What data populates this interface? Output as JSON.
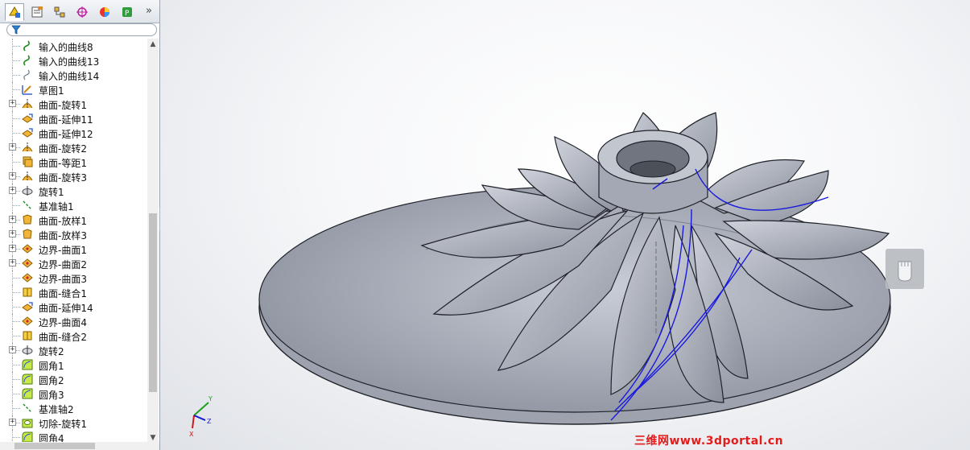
{
  "panel": {
    "tabs": [
      {
        "name": "featuremanager-tab",
        "icon": "featuremanager-icon"
      },
      {
        "name": "propertymanager-tab",
        "icon": "propertymanager-icon"
      },
      {
        "name": "configurationmanager-tab",
        "icon": "configurationmanager-icon"
      },
      {
        "name": "dimxpert-tab",
        "icon": "dimxpert-icon"
      },
      {
        "name": "display-manager-tab",
        "icon": "display-manager-icon"
      },
      {
        "name": "photoview-tab",
        "icon": "photoview-icon"
      }
    ],
    "more_glyph": "»",
    "tree": [
      {
        "label": "输入的曲线8",
        "icon": "curve-icon",
        "expandable": false
      },
      {
        "label": "输入的曲线13",
        "icon": "curve-icon",
        "expandable": false
      },
      {
        "label": "输入的曲线14",
        "icon": "curve-faded-icon",
        "expandable": false
      },
      {
        "label": "草图1",
        "icon": "sketch-icon",
        "expandable": false
      },
      {
        "label": "曲面-旋转1",
        "icon": "surface-revolve-icon",
        "expandable": true
      },
      {
        "label": "曲面-延伸11",
        "icon": "surface-extend-icon",
        "expandable": false
      },
      {
        "label": "曲面-延伸12",
        "icon": "surface-extend-icon",
        "expandable": false
      },
      {
        "label": "曲面-旋转2",
        "icon": "surface-revolve-icon",
        "expandable": true
      },
      {
        "label": "曲面-等距1",
        "icon": "surface-offset-icon",
        "expandable": false
      },
      {
        "label": "曲面-旋转3",
        "icon": "surface-revolve-icon",
        "expandable": true
      },
      {
        "label": "旋转1",
        "icon": "revolve-icon",
        "expandable": true
      },
      {
        "label": "基准轴1",
        "icon": "axis-icon",
        "expandable": false
      },
      {
        "label": "曲面-放样1",
        "icon": "surface-loft-icon",
        "expandable": true
      },
      {
        "label": "曲面-放样3",
        "icon": "surface-loft-icon",
        "expandable": true
      },
      {
        "label": "边界-曲面1",
        "icon": "boundary-surface-icon",
        "expandable": true
      },
      {
        "label": "边界-曲面2",
        "icon": "boundary-surface-icon",
        "expandable": true
      },
      {
        "label": "边界-曲面3",
        "icon": "boundary-surface-icon",
        "expandable": false
      },
      {
        "label": "曲面-缝合1",
        "icon": "surface-knit-icon",
        "expandable": false
      },
      {
        "label": "曲面-延伸14",
        "icon": "surface-extend-icon",
        "expandable": false
      },
      {
        "label": "边界-曲面4",
        "icon": "boundary-surface-icon",
        "expandable": false
      },
      {
        "label": "曲面-缝合2",
        "icon": "surface-knit-icon",
        "expandable": false
      },
      {
        "label": "旋转2",
        "icon": "revolve-icon",
        "expandable": true
      },
      {
        "label": "圆角1",
        "icon": "fillet-icon",
        "expandable": false
      },
      {
        "label": "圆角2",
        "icon": "fillet-icon",
        "expandable": false
      },
      {
        "label": "圆角3",
        "icon": "fillet-icon",
        "expandable": false
      },
      {
        "label": "基准轴2",
        "icon": "axis-icon",
        "expandable": false
      },
      {
        "label": "切除-旋转1",
        "icon": "cut-revolve-icon",
        "expandable": true
      },
      {
        "label": "圆角4",
        "icon": "fillet-icon",
        "expandable": false
      }
    ]
  },
  "viewport": {
    "triad": {
      "x": "X",
      "y": "Y",
      "z": "Z"
    },
    "watermark": "三维网www.3dportal.cn"
  },
  "colors": {
    "model_fill": "#aeb3c0",
    "model_edge": "#1f2228",
    "curve_blue": "#1a1adf",
    "axis_x": "#d01818",
    "axis_y": "#1aa01a",
    "axis_z": "#1818d0",
    "watermark": "#e21b1b"
  }
}
